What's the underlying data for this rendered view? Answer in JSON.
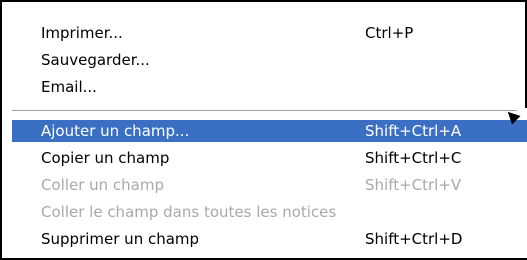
{
  "menu": {
    "items_top": [
      {
        "label": "Imprimer...",
        "shortcut": "Ctrl+P",
        "enabled": true
      },
      {
        "label": "Sauvegarder...",
        "shortcut": "",
        "enabled": true
      },
      {
        "label": "Email...",
        "shortcut": "",
        "enabled": true
      }
    ],
    "items_bottom": [
      {
        "label": "Ajouter un champ...",
        "shortcut": "Shift+Ctrl+A",
        "enabled": true,
        "highlighted": true
      },
      {
        "label": "Copier un champ",
        "shortcut": "Shift+Ctrl+C",
        "enabled": true
      },
      {
        "label": "Coller un champ",
        "shortcut": "Shift+Ctrl+V",
        "enabled": false
      },
      {
        "label": "Coller le champ dans toutes les notices",
        "shortcut": "",
        "enabled": false
      },
      {
        "label": "Supprimer un champ",
        "shortcut": "Shift+Ctrl+D",
        "enabled": true
      }
    ]
  },
  "colors": {
    "highlight_bg": "#3a6fc4",
    "highlight_text": "#ffffff",
    "disabled_text": "#a9a9a9",
    "text": "#000000"
  }
}
